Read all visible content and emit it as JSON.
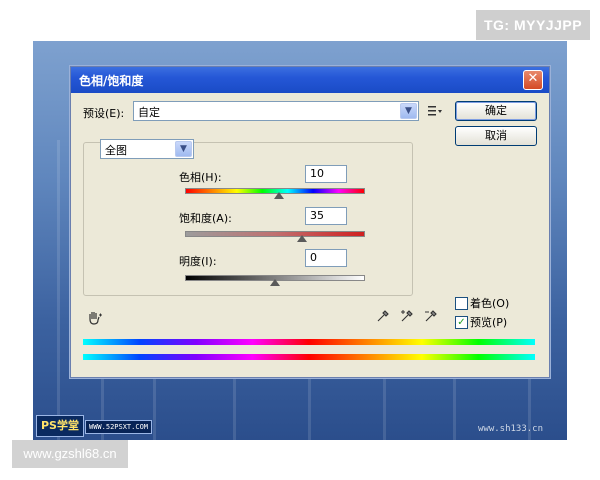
{
  "watermark_top": "TG: MYYJJPP",
  "watermark_bottom": "www.gzshl68.cn",
  "desktop": {
    "logo_text": "PS学堂",
    "logo_url": "WWW.52PSXT.COM",
    "corner_url": "www.sh133.cn"
  },
  "dialog": {
    "title": "色相/饱和度",
    "close_label": "✕",
    "preset_label": "预设(E):",
    "preset_value": "自定",
    "ok_label": "确定",
    "cancel_label": "取消",
    "range_value": "全图",
    "hue_label": "色相(H):",
    "hue_value": "10",
    "saturation_label": "饱和度(A):",
    "saturation_value": "35",
    "lightness_label": "明度(I):",
    "lightness_value": "0",
    "colorize_label": "着色(O)",
    "preview_label": "预览(P)",
    "colorize_checked": false,
    "preview_checked": true,
    "hue_check_mark": "✓"
  },
  "icons": {
    "menu": "list-menu-icon",
    "hand": "hand-tool-icon",
    "eyedropper": "eyedropper-icon",
    "eyedropper_plus": "eyedropper-plus-icon",
    "eyedropper_minus": "eyedropper-minus-icon"
  },
  "colors": {
    "titlebar": "#2557d6",
    "dialog_bg": "#ece9d8",
    "close_button": "#d44a24"
  }
}
